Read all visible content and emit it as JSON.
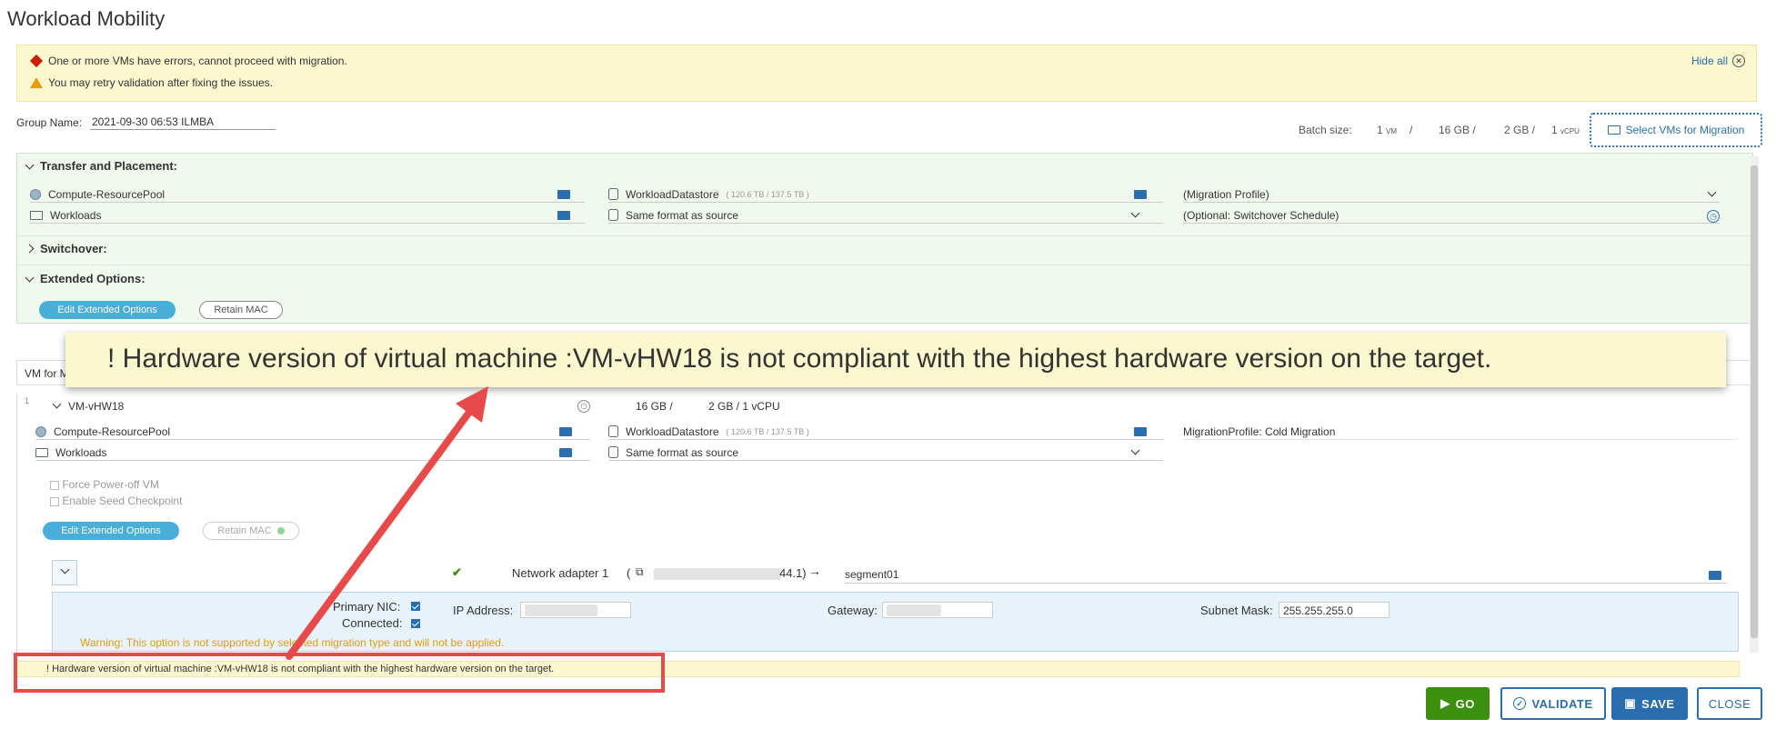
{
  "page_title": "Workload Mobility",
  "alerts": {
    "error_text": "One or more VMs have errors, cannot proceed with migration.",
    "warning_text": "You may retry validation after fixing the issues.",
    "hide_all_label": "Hide all"
  },
  "group": {
    "label": "Group Name:",
    "value": "2021-09-30 06:53 ILMBA"
  },
  "batch": {
    "label": "Batch size:",
    "vm_count": "1",
    "vm_unit": "VM",
    "sep1": "/",
    "storage": "16 GB /",
    "memory": "2 GB /",
    "vcpu_count": "1",
    "vcpu_unit": "vCPU",
    "select_button": "Select VMs for Migration"
  },
  "transfer": {
    "section_label": "Transfer and Placement:",
    "compute": "Compute-ResourcePool",
    "folder": "Workloads",
    "datastore": "WorkloadDatastore",
    "datastore_capacity": "( 120.6 TB / 137.5 TB )",
    "disk_format": "Same format as source",
    "migration_profile": "(Migration Profile)",
    "switchover_schedule": "(Optional: Switchover Schedule)"
  },
  "switchover_label": "Switchover:",
  "extended": {
    "section_label": "Extended Options:",
    "edit_button": "Edit Extended Options",
    "retain_mac_button": "Retain MAC"
  },
  "callout_text": "! Hardware version of virtual machine :VM-vHW18 is not compliant with the highest hardware version on the target.",
  "vm_list_label": "VM for M",
  "vm": {
    "index": "1",
    "name": "VM-vHW18",
    "storage": "16 GB /",
    "memory_cpu": "2 GB / 1 vCPU",
    "compute": "Compute-ResourcePool",
    "folder": "Workloads",
    "datastore": "WorkloadDatastore",
    "datastore_capacity": "( 120.6 TB / 137.5 TB )",
    "disk_format": "Same format as source",
    "migration_profile": "MigrationProfile: Cold Migration",
    "force_poweroff": "Force Power-off VM",
    "seed_checkpoint": "Enable Seed Checkpoint",
    "edit_button": "Edit Extended Options",
    "retain_mac_button": "Retain MAC"
  },
  "network": {
    "adapter_label": "Network adapter 1",
    "adapter_open": "(",
    "adapter_suffix": "44.1)",
    "arrow": "→",
    "segment": "segment01",
    "primary_nic_label": "Primary NIC:",
    "connected_label": "Connected:",
    "ip_label": "IP Address:",
    "gateway_label": "Gateway:",
    "subnet_label": "Subnet Mask:",
    "subnet_value": "255.255.255.0",
    "warning": "Warning: This option is not supported by selected migration type and will not be applied."
  },
  "bottom_error": "! Hardware version of virtual machine :VM-vHW18 is not compliant with the highest hardware version on the target.",
  "footer": {
    "go": "GO",
    "validate": "VALIDATE",
    "save": "SAVE",
    "close": "CLOSE"
  },
  "colors": {
    "accent": "#2a6eb0",
    "go_green": "#3d8f0f",
    "annotation_red": "#e84a4a",
    "alert_yellow": "#fbf8d0",
    "panel_green": "#f1f9ef"
  }
}
